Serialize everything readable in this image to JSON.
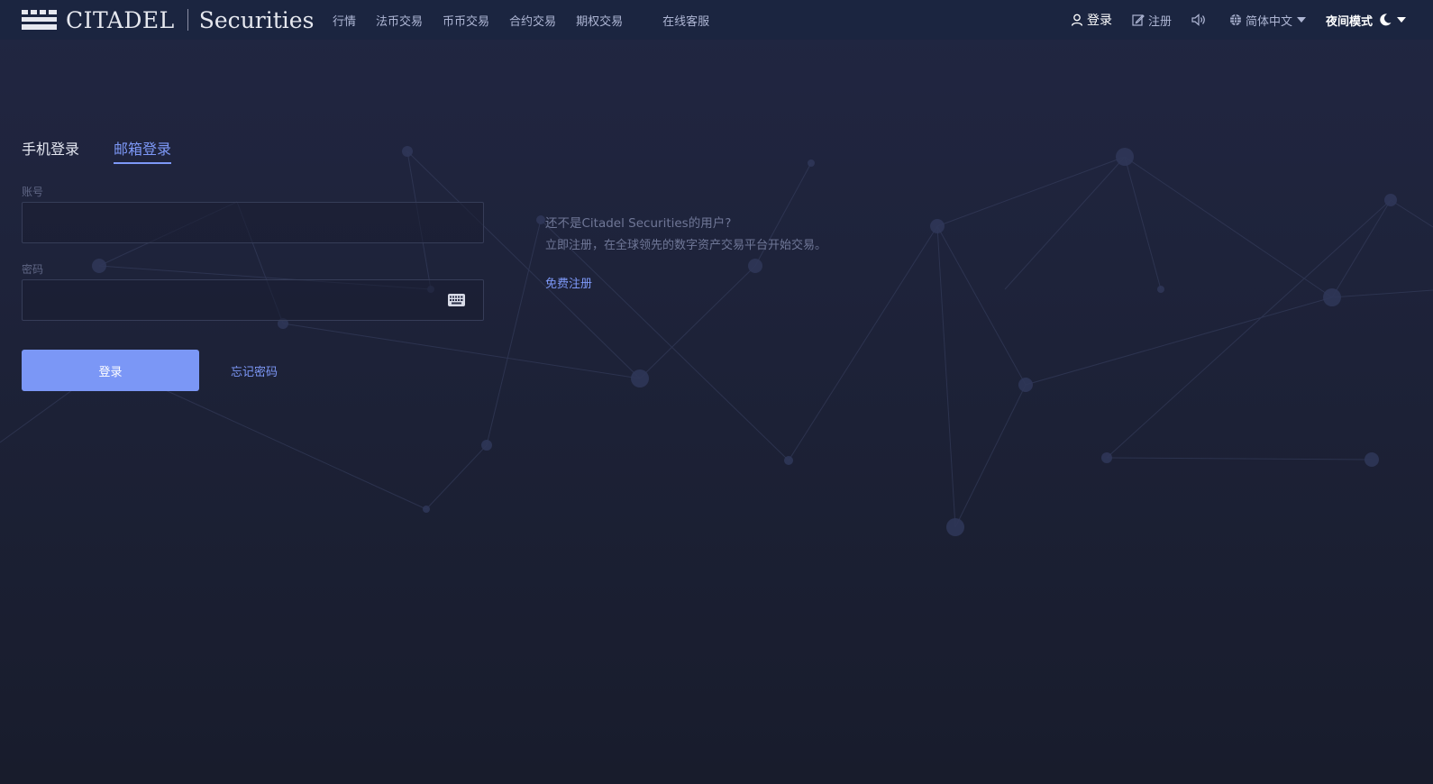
{
  "header": {
    "brand": "CITADEL",
    "brand_sub": "Securities",
    "nav": [
      "行情",
      "法币交易",
      "币币交易",
      "合约交易",
      "期权交易"
    ],
    "service": "在线客服",
    "login": "登录",
    "register": "注册",
    "language": "简体中文",
    "night_mode": "夜间模式"
  },
  "login": {
    "tabs": [
      "手机登录",
      "邮箱登录"
    ],
    "active_tab": "邮箱登录",
    "account_label": "账号",
    "account_value": "",
    "password_label": "密码",
    "password_value": "",
    "submit": "登录",
    "forgot": "忘记密码"
  },
  "promo": {
    "title": "还不是Citadel Securities的用户?",
    "desc": "立即注册，在全球领先的数字资产交易平台开始交易。",
    "link": "免费注册"
  },
  "colors": {
    "accent": "#7d98f7",
    "button": "#7b97f6",
    "header_bg": "#1b2540",
    "page_bg": "#1d2238"
  },
  "icons": {
    "logo": "citadel-logo-icon",
    "login": "user-icon",
    "register": "edit-icon",
    "sound": "speaker-icon",
    "language": "globe-icon",
    "night": "moon-icon",
    "keyboard": "keyboard-icon"
  }
}
